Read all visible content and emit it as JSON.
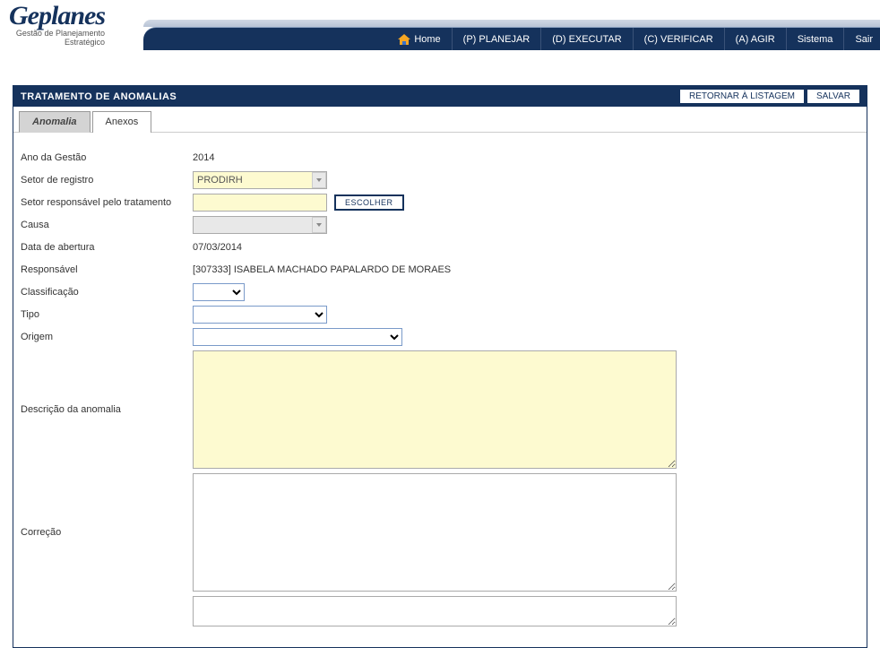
{
  "logo": {
    "title": "Geplanes",
    "subtitle_line1": "Gestão de Planejamento",
    "subtitle_line2": "Estratégico"
  },
  "nav": {
    "home": "Home",
    "planejar": "(P) PLANEJAR",
    "executar": "(D) EXECUTAR",
    "verificar": "(C) VERIFICAR",
    "agir": "(A) AGIR",
    "sistema": "Sistema",
    "sair": "Sair"
  },
  "page": {
    "title": "TRATAMENTO DE ANOMALIAS",
    "btn_retornar": "RETORNAR À LISTAGEM",
    "btn_salvar": "SALVAR"
  },
  "tabs": {
    "anomalia": "Anomalia",
    "anexos": "Anexos"
  },
  "form": {
    "ano_label": "Ano da Gestão",
    "ano_value": "2014",
    "setor_registro_label": "Setor de registro",
    "setor_registro_value": "PRODIRH",
    "setor_resp_label": "Setor responsável pelo tratamento",
    "setor_resp_value": "",
    "btn_escolher": "ESCOLHER",
    "causa_label": "Causa",
    "causa_value": "",
    "data_abertura_label": "Data de abertura",
    "data_abertura_value": "07/03/2014",
    "responsavel_label": "Responsável",
    "responsavel_value": "[307333] ISABELA MACHADO PAPALARDO DE MORAES",
    "classificacao_label": "Classificação",
    "tipo_label": "Tipo",
    "origem_label": "Origem",
    "descricao_label": "Descrição da anomalia",
    "correcao_label": "Correção"
  }
}
